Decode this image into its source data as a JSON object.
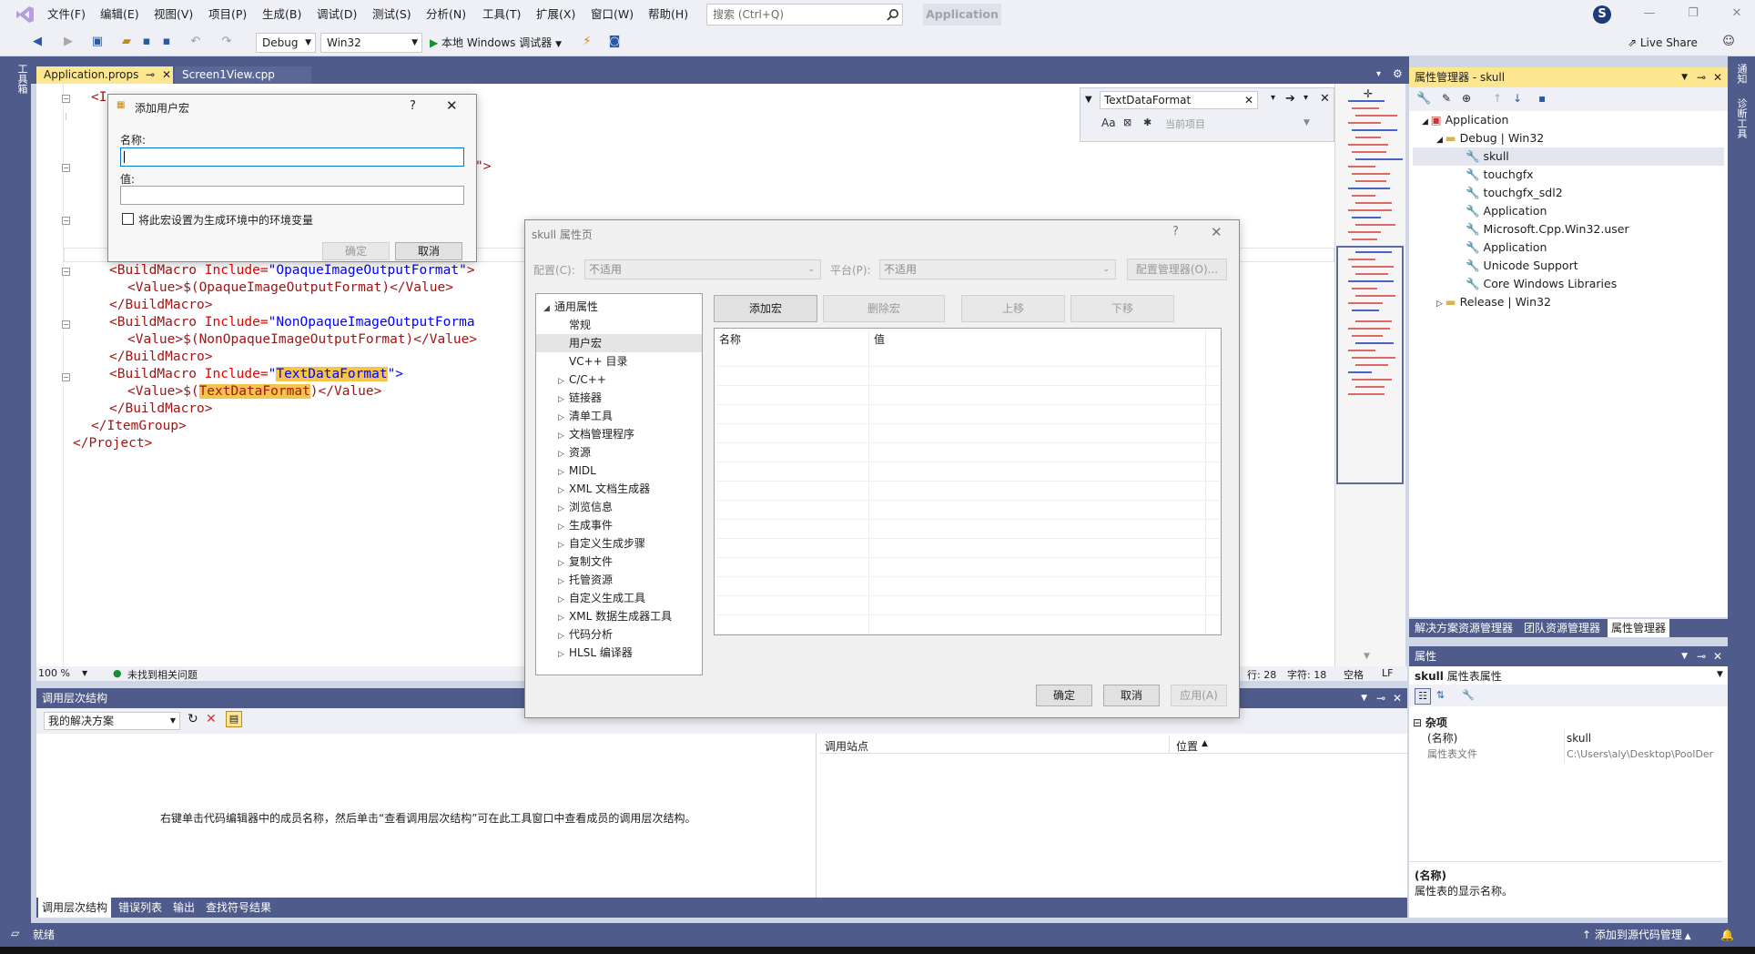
{
  "menu": [
    "文件(F)",
    "编辑(E)",
    "视图(V)",
    "项目(P)",
    "生成(B)",
    "调试(D)",
    "测试(S)",
    "分析(N)",
    "工具(T)",
    "扩展(X)",
    "窗口(W)",
    "帮助(H)"
  ],
  "search_placeholder": "搜索 (Ctrl+Q)",
  "app_badge": "Application",
  "avatar_letter": "S",
  "toolbar": {
    "config": "Debug",
    "platform": "Win32",
    "run_label": "本地 Windows 调试器",
    "live_share": "Live Share"
  },
  "left_strip_label": "工具箱",
  "right_strip_labels": [
    "通知",
    "诊断工具"
  ],
  "tabs": [
    {
      "label": "Application.props"
    },
    {
      "label": "Screen1View.cpp"
    }
  ],
  "code": {
    "l1_open": "<I",
    "l_gt": "\">",
    "bm1_open": "<BuildMacro ",
    "bm1_attr": "Include=",
    "bm1_val": "\"OpaqueImageOutputFormat\"",
    "bm1_close": ">",
    "val1": "<Value>$(OpaqueImageOutputFormat)</Value>",
    "bm_end": "</BuildMacro>",
    "bm2_open": "<BuildMacro ",
    "bm2_attr": "Include=",
    "bm2_val": "\"NonOpaqueImageOutputForma",
    "val2": "<Value>$(NonOpaqueImageOutputFormat)</Value>",
    "bm3_open": "<BuildMacro ",
    "bm3_attr": "Include=",
    "bm3_val_q": "\"",
    "bm3_val_hl": "TextDataFormat",
    "bm3_val_end": "\">",
    "val3_a": "<Value>$(",
    "val3_hl": "TextDataFormat",
    "val3_b": ")</Value>",
    "itemgroup_end": "</ItemGroup>",
    "project_end": "</Project>"
  },
  "find": {
    "value": "TextDataFormat",
    "scope": "当前项目",
    "options": "Aa"
  },
  "editor_status": {
    "zoom": "100 %",
    "issues": "未找到相关问题",
    "line": "行: 28",
    "col": "字符: 18",
    "spaces": "空格",
    "eol": "LF"
  },
  "solution": {
    "header": "属性管理器 - skull",
    "rows": [
      "Application",
      "Debug | Win32",
      "skull",
      "touchgfx",
      "touchgfx_sdl2",
      "Application",
      "Microsoft.Cpp.Win32.user",
      "Application",
      "Unicode Support",
      "Core Windows Libraries",
      "Release | Win32"
    ],
    "tabs": [
      "解决方案资源管理器",
      "团队资源管理器",
      "属性管理器"
    ]
  },
  "properties": {
    "header": "属性",
    "object": "skull",
    "object_type": "属性表属性",
    "category": "杂项",
    "rows": [
      {
        "name": "(名称)",
        "value": "skull"
      },
      {
        "name": "属性表文件",
        "value": "C:\\Users\\aly\\Desktop\\PoolDer"
      }
    ],
    "desc_title": "(名称)",
    "desc_text": "属性表的显示名称。"
  },
  "callhier": {
    "header": "调用层次结构",
    "scope": "我的解决方案",
    "hint": "右键单击代码编辑器中的成员名称，然后单击“查看调用层次结构”可在此工具窗口中查看成员的调用层次结构。",
    "col_site": "调用站点",
    "col_loc": "位置"
  },
  "bottom_tabs": [
    "调用层次结构",
    "错误列表",
    "输出",
    "查找符号结果"
  ],
  "status": {
    "ready": "就绪",
    "source_control": "添加到源代码管理"
  },
  "macro_dialog": {
    "title": "添加用户宏",
    "help": "?",
    "name_label": "名称:",
    "value_label": "值:",
    "checkbox_label": "将此宏设置为生成环境中的环境变量",
    "ok": "确定",
    "cancel": "取消"
  },
  "prop_dialog": {
    "title": "skull 属性页",
    "help": "?",
    "config_label": "配置(C):",
    "config_value": "不适用",
    "platform_label": "平台(P):",
    "platform_value": "不适用",
    "config_mgr": "配置管理器(O)...",
    "tree": [
      {
        "label": "通用属性",
        "level": 0,
        "exp": "open"
      },
      {
        "label": "常规",
        "level": 1,
        "exp": ""
      },
      {
        "label": "用户宏",
        "level": 1,
        "exp": "",
        "sel": true
      },
      {
        "label": "VC++ 目录",
        "level": 1,
        "exp": ""
      },
      {
        "label": "C/C++",
        "level": 1,
        "exp": "closed"
      },
      {
        "label": "链接器",
        "level": 1,
        "exp": "closed"
      },
      {
        "label": "清单工具",
        "level": 1,
        "exp": "closed"
      },
      {
        "label": "文档管理程序",
        "level": 1,
        "exp": "closed"
      },
      {
        "label": "资源",
        "level": 1,
        "exp": "closed"
      },
      {
        "label": "MIDL",
        "level": 1,
        "exp": "closed"
      },
      {
        "label": "XML 文档生成器",
        "level": 1,
        "exp": "closed"
      },
      {
        "label": "浏览信息",
        "level": 1,
        "exp": "closed"
      },
      {
        "label": "生成事件",
        "level": 1,
        "exp": "closed"
      },
      {
        "label": "自定义生成步骤",
        "level": 1,
        "exp": "closed"
      },
      {
        "label": "复制文件",
        "level": 1,
        "exp": "closed"
      },
      {
        "label": "托管资源",
        "level": 1,
        "exp": "closed"
      },
      {
        "label": "自定义生成工具",
        "level": 1,
        "exp": "closed"
      },
      {
        "label": "XML 数据生成器工具",
        "level": 1,
        "exp": "closed"
      },
      {
        "label": "代码分析",
        "level": 1,
        "exp": "closed"
      },
      {
        "label": "HLSL 编译器",
        "level": 1,
        "exp": "closed"
      }
    ],
    "add_macro": "添加宏",
    "delete_macro": "删除宏",
    "move_up": "上移",
    "move_down": "下移",
    "col_name": "名称",
    "col_value": "值",
    "ok": "确定",
    "cancel": "取消",
    "apply": "应用(A)"
  }
}
